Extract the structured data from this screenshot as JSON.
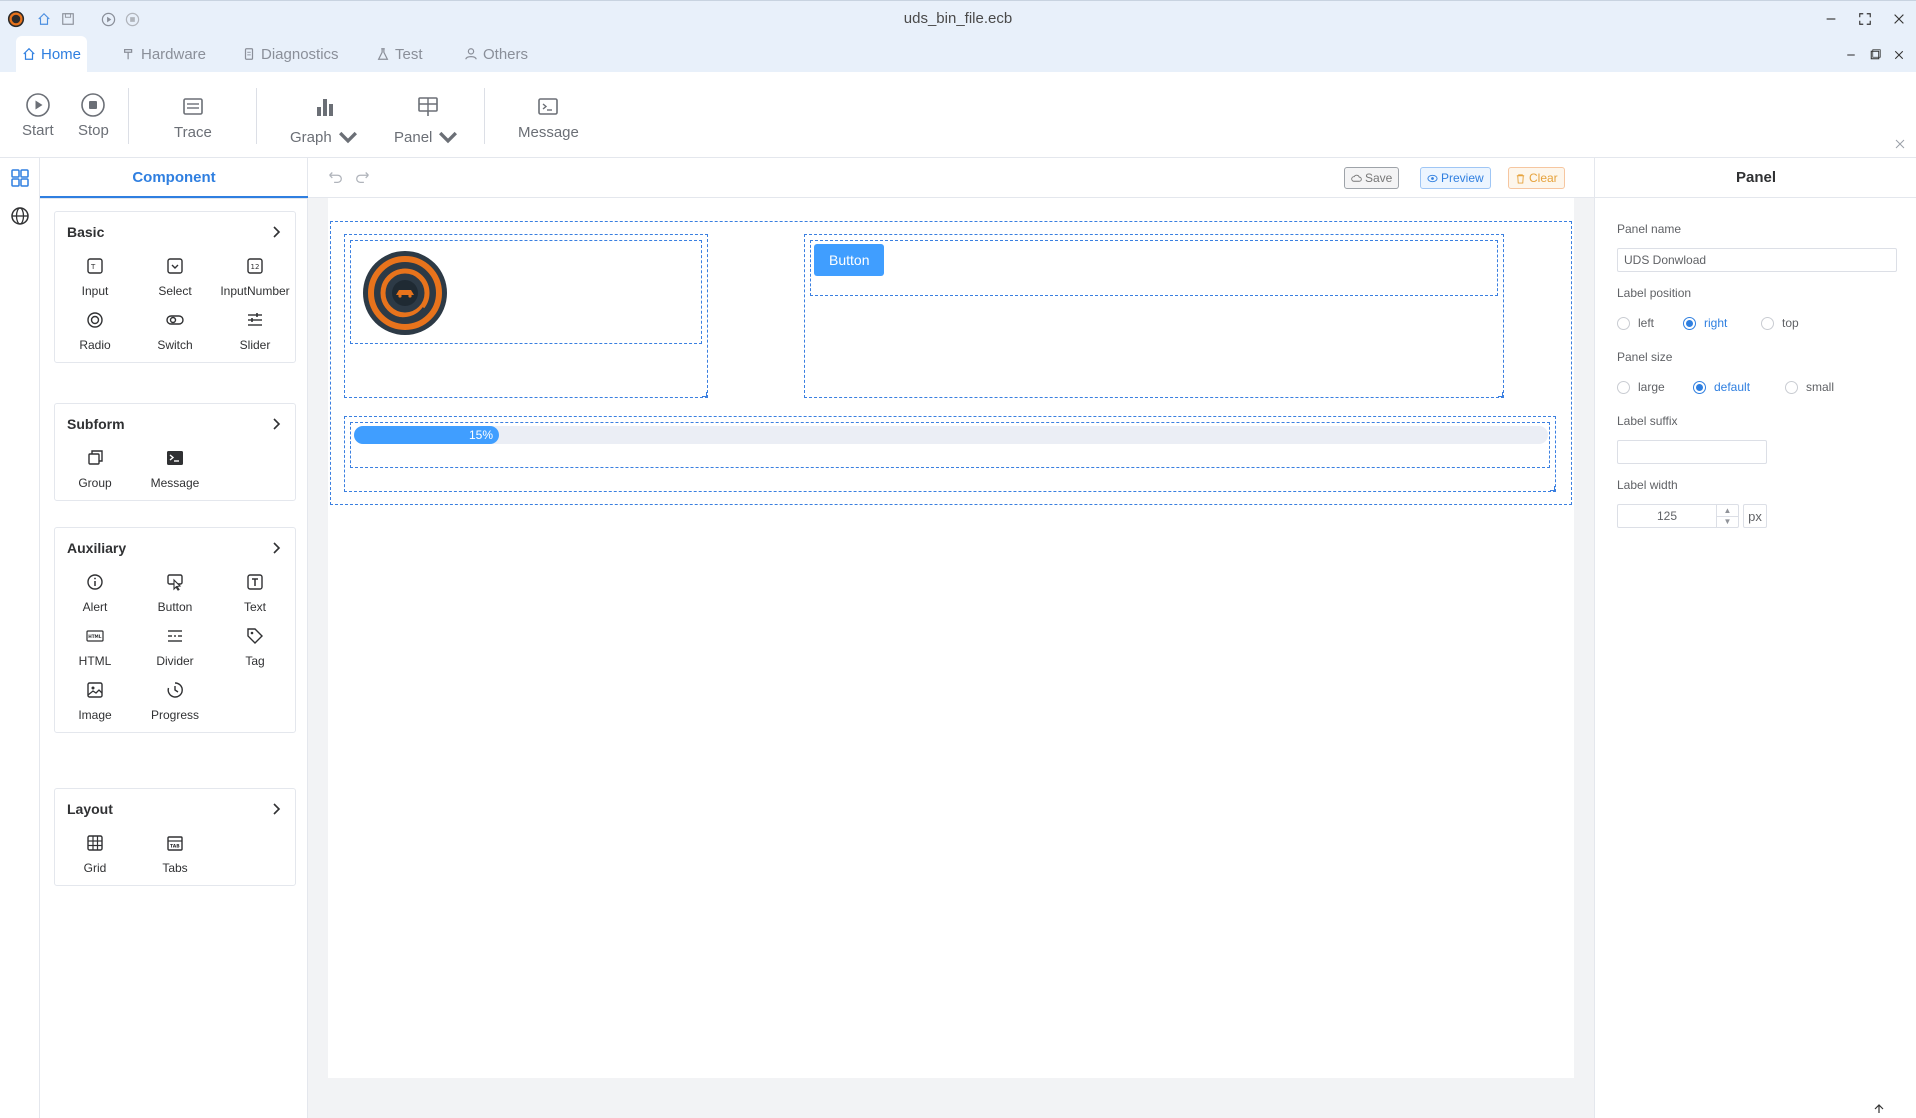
{
  "window": {
    "title": "uds_bin_file.ecb"
  },
  "menu": {
    "tabs": [
      {
        "label": "Home",
        "icon": "home-icon"
      },
      {
        "label": "Hardware",
        "icon": "hammer-icon"
      },
      {
        "label": "Diagnostics",
        "icon": "diagnostics-icon"
      },
      {
        "label": "Test",
        "icon": "flask-icon"
      },
      {
        "label": "Others",
        "icon": "user-icon"
      }
    ]
  },
  "ribbon": {
    "start": "Start",
    "stop": "Stop",
    "trace": "Trace",
    "graph": "Graph",
    "panel": "Panel",
    "message": "Message"
  },
  "component_panel": {
    "tab_label": "Component",
    "groups": [
      {
        "title": "Basic",
        "items": [
          "Input",
          "Select",
          "InputNumber",
          "Radio",
          "Switch",
          "Slider"
        ]
      },
      {
        "title": "Subform",
        "items": [
          "Group",
          "Message"
        ]
      },
      {
        "title": "Auxiliary",
        "items": [
          "Alert",
          "Button",
          "Text",
          "HTML",
          "Divider",
          "Tag",
          "Image",
          "Progress"
        ]
      },
      {
        "title": "Layout",
        "items": [
          "Grid",
          "Tabs"
        ]
      }
    ]
  },
  "canvas_toolbar": {
    "save": "Save",
    "preview": "Preview",
    "clear": "Clear"
  },
  "canvas": {
    "button_label": "Button",
    "progress": {
      "percent": 15,
      "label": "15%"
    }
  },
  "properties": {
    "title": "Panel",
    "panel_name_label": "Panel name",
    "panel_name_value": "UDS Donwload",
    "label_position_label": "Label position",
    "label_position_options": [
      "left",
      "right",
      "top"
    ],
    "label_position_selected": "right",
    "panel_size_label": "Panel size",
    "panel_size_options": [
      "large",
      "default",
      "small"
    ],
    "panel_size_selected": "default",
    "label_suffix_label": "Label suffix",
    "label_suffix_value": "",
    "label_width_label": "Label width",
    "label_width_value": "125",
    "label_width_unit": "px"
  },
  "colors": {
    "accent": "#2f7fe0",
    "primary_button": "#409eff",
    "titlebar": "#e8f0fa",
    "clear": "#e6a23c"
  }
}
